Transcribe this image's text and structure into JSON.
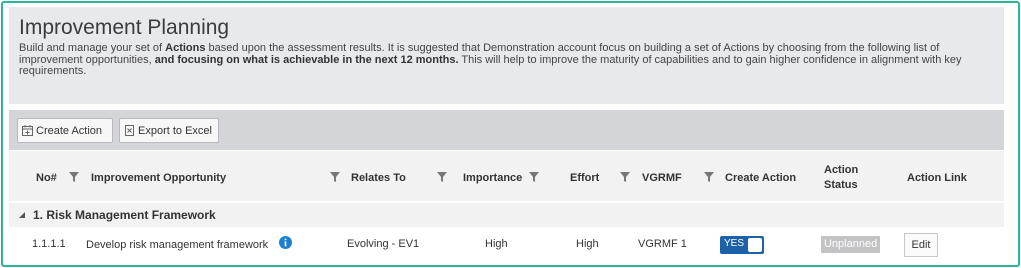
{
  "header": {
    "title": "Improvement Planning",
    "desc_part1": "Build and manage your set of ",
    "desc_bold1": "Actions",
    "desc_part2": " based upon the assessment results. It is suggested that Demonstration account focus on building a set of Actions by choosing from the following list of improvement opportunities, ",
    "desc_bold2": "and focusing on what is achievable in the next 12 months.",
    "desc_part3": " This will help to improve the maturity of capabilities and to gain higher confidence in alignment with key requirements."
  },
  "toolbar": {
    "create_action_label": "Create Action",
    "export_label": "Export to Excel"
  },
  "columns": {
    "no": "No#",
    "opportunity": "Improvement Opportunity",
    "relates_to": "Relates To",
    "importance": "Importance",
    "effort": "Effort",
    "vgrmf": "VGRMF",
    "create_action": "Create Action",
    "action_status_1": "Action",
    "action_status_2": "Status",
    "action_link": "Action Link"
  },
  "groups": [
    {
      "label": "1. Risk Management Framework",
      "rows": [
        {
          "no": "1.1.1.1",
          "opportunity": "Develop risk management framework",
          "relates_to": "Evolving - EV1",
          "importance": "High",
          "effort": "High",
          "vgrmf": "VGRMF 1",
          "create_action": "YES",
          "action_status": "Unplanned",
          "action_link": "Edit"
        }
      ]
    }
  ],
  "colors": {
    "frame_border": "#2fb39a",
    "toggle_on": "#1d62a8",
    "status_badge": "#c3c3c5",
    "info_icon": "#1d7fd0"
  }
}
